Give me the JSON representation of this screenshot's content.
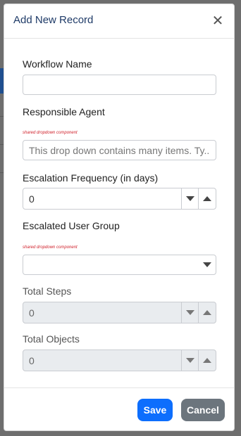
{
  "modal": {
    "title": "Add New Record",
    "close_glyph": "✕"
  },
  "form": {
    "workflow_name": {
      "label": "Workflow Name",
      "value": ""
    },
    "responsible_agent": {
      "label": "Responsible Agent",
      "component_note": "shared dropdown component",
      "placeholder": "This drop down contains many items. Ty..."
    },
    "escalation_frequency": {
      "label": "Escalation Frequency (in days)",
      "value": "0"
    },
    "escalated_user_group": {
      "label": "Escalated User Group",
      "component_note": "shared dropdown component",
      "value": ""
    },
    "total_steps": {
      "label": "Total Steps",
      "value": "0"
    },
    "total_objects": {
      "label": "Total Objects",
      "value": "0"
    }
  },
  "footer": {
    "save_label": "Save",
    "cancel_label": "Cancel"
  },
  "colors": {
    "save": "#0d6efd",
    "cancel": "#6c757d",
    "title": "#1e3a67",
    "component_note": "#d0212b"
  }
}
